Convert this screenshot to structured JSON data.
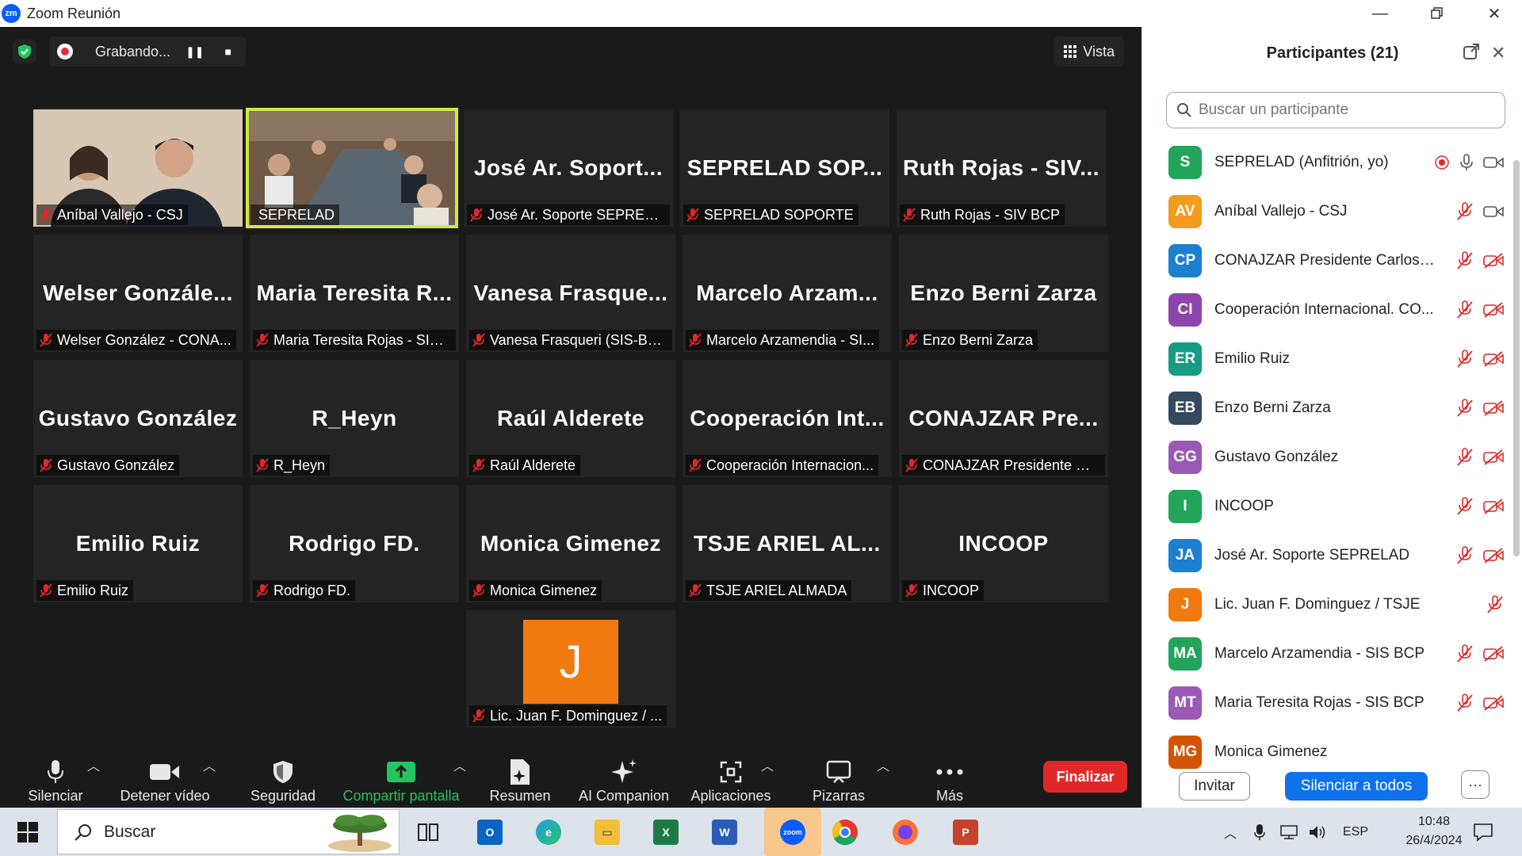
{
  "window": {
    "title": "Zoom Reunión",
    "logo": "zm"
  },
  "topbar": {
    "recording": "Grabando...",
    "view": "Vista"
  },
  "tiles": [
    {
      "big": "",
      "label": "Aníbal Vallejo - CSJ"
    },
    {
      "big": "",
      "label": "SEPRELAD"
    },
    {
      "big": "José Ar. Soport...",
      "label": "José Ar. Soporte SEPRELAD"
    },
    {
      "big": "SEPRELAD SOP...",
      "label": "SEPRELAD SOPORTE"
    },
    {
      "big": "Ruth Rojas - SIV...",
      "label": "Ruth Rojas - SIV BCP"
    },
    {
      "big": "Welser Gonzále...",
      "label": "Welser González - CONA..."
    },
    {
      "big": "Maria Teresita R...",
      "label": "Maria Teresita Rojas - SIS ..."
    },
    {
      "big": "Vanesa Frasque...",
      "label": "Vanesa Frasqueri (SIS-BCP)"
    },
    {
      "big": "Marcelo Arzam...",
      "label": "Marcelo Arzamendia - SI..."
    },
    {
      "big": "Enzo Berni Zarza",
      "label": "Enzo Berni Zarza"
    },
    {
      "big": "Gustavo González",
      "label": "Gustavo González"
    },
    {
      "big": "R_Heyn",
      "label": "R_Heyn"
    },
    {
      "big": "Raúl Alderete",
      "label": "Raúl Alderete"
    },
    {
      "big": "Cooperación Int...",
      "label": "Cooperación Internacion..."
    },
    {
      "big": "CONAJZAR Pre...",
      "label": "CONAJZAR Presidente Ca..."
    },
    {
      "big": "Emilio Ruiz",
      "label": "Emilio Ruiz"
    },
    {
      "big": "Rodrigo FD.",
      "label": "Rodrigo FD."
    },
    {
      "big": "Monica Gimenez",
      "label": "Monica Gimenez"
    },
    {
      "big": "TSJE ARIEL AL...",
      "label": "TSJE ARIEL ALMADA"
    },
    {
      "big": "INCOOP",
      "label": "INCOOP"
    },
    {
      "big": "J",
      "label": "Lic. Juan F. Dominguez / ..."
    }
  ],
  "toolbar": {
    "mute": "Silenciar",
    "video": "Detener vídeo",
    "security": "Seguridad",
    "share": "Compartir pantalla",
    "summary": "Resumen",
    "ai": "AI Companion",
    "apps": "Aplicaciones",
    "whiteboards": "Pizarras",
    "more": "Más",
    "end": "Finalizar"
  },
  "panel": {
    "title": "Participantes (21)",
    "search_placeholder": "Buscar un participante",
    "invite": "Invitar",
    "mute_all": "Silenciar a todos",
    "more": "···",
    "participants": [
      {
        "initials": "S",
        "name": "SEPRELAD (Anfitrión, yo)",
        "color": "#22a55a"
      },
      {
        "initials": "AV",
        "name": "Aníbal Vallejo - CSJ",
        "color": "#f39c1f"
      },
      {
        "initials": "CP",
        "name": "CONAJZAR Presidente Carlos Li...",
        "color": "#1c7fd0"
      },
      {
        "initials": "CI",
        "name": "Cooperación Internacional. CO...",
        "color": "#8e44ad"
      },
      {
        "initials": "ER",
        "name": "Emilio Ruiz",
        "color": "#169c85"
      },
      {
        "initials": "EB",
        "name": "Enzo Berni Zarza",
        "color": "#34495e"
      },
      {
        "initials": "GG",
        "name": "Gustavo González",
        "color": "#9b59b6"
      },
      {
        "initials": "I",
        "name": "INCOOP",
        "color": "#22a55a"
      },
      {
        "initials": "JA",
        "name": "José Ar. Soporte SEPRELAD",
        "color": "#1c7fd0"
      },
      {
        "initials": "J",
        "name": "Lic. Juan F. Dominguez / TSJE",
        "color": "#f07a10"
      },
      {
        "initials": "MA",
        "name": "Marcelo Arzamendia - SIS BCP",
        "color": "#22a55a"
      },
      {
        "initials": "MT",
        "name": "Maria Teresita Rojas - SIS BCP",
        "color": "#9b59b6"
      },
      {
        "initials": "MG",
        "name": "Monica Gimenez",
        "color": "#d35400"
      }
    ]
  },
  "taskbar": {
    "search": "Buscar",
    "lang": "ESP",
    "time": "10:48",
    "date": "26/4/2024"
  },
  "colors": {
    "accent_blue": "#0e72ed",
    "end_red": "#e02828",
    "active_speaker": "#cfe84a",
    "share_green": "#22c55e"
  }
}
